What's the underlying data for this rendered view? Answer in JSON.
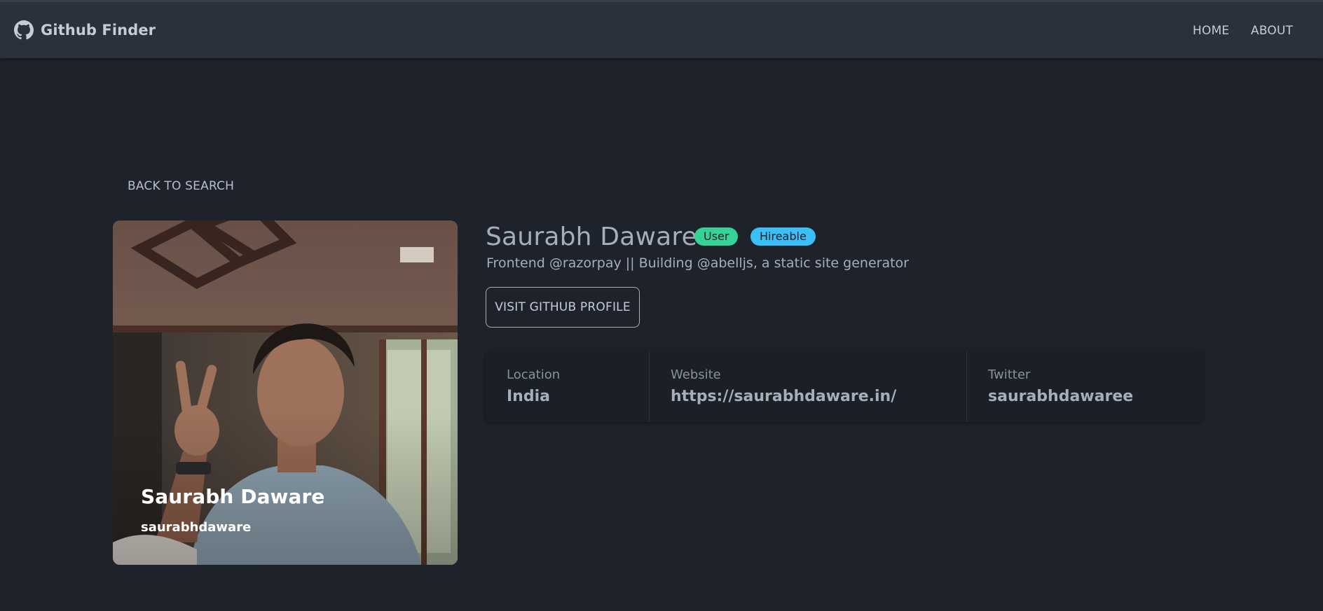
{
  "app": {
    "title": "Github Finder"
  },
  "nav": {
    "home": "HOME",
    "about": "ABOUT"
  },
  "back_label": "BACK TO SEARCH",
  "profile": {
    "name": "Saurabh Daware",
    "login": "saurabhdaware",
    "type_badge": "User",
    "hireable_badge": "Hireable",
    "bio": "Frontend @razorpay || Building @abelljs, a static site generator",
    "visit_label": "VISIT GITHUB PROFILE"
  },
  "stats": [
    {
      "title": "Location",
      "value": "India"
    },
    {
      "title": "Website",
      "value": "https://saurabhdaware.in/"
    },
    {
      "title": "Twitter",
      "value": "saurabhdawaree"
    }
  ],
  "colors": {
    "background": "#1e222a",
    "navbar": "#2a303c",
    "badge_user": "#36d399",
    "badge_hireable": "#3abff8"
  }
}
